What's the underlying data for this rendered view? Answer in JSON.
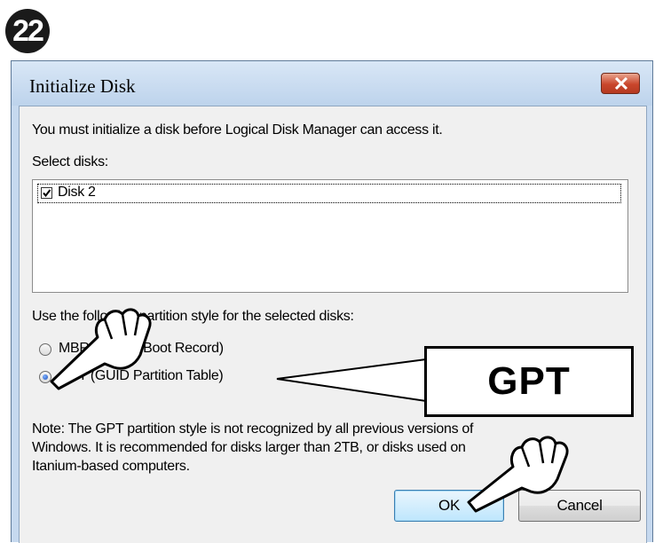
{
  "step_number": "22",
  "dialog": {
    "title": "Initialize Disk",
    "message": "You must initialize a disk before Logical Disk Manager can access it.",
    "select_disks_label": "Select disks:",
    "disks": [
      {
        "label": "Disk 2",
        "checked": true
      }
    ],
    "partition_style_label": "Use the following partition style for the selected disks:",
    "partition_options": [
      {
        "label": "MBR (Master Boot Record)",
        "selected": false
      },
      {
        "label": "GPT (GUID Partition Table)",
        "selected": true
      }
    ],
    "note_lines": [
      "Note: The GPT partition style is not recognized by all previous versions of",
      "Windows. It is recommended for disks larger than 2TB, or disks used on",
      "Itanium-based computers."
    ],
    "ok_label": "OK",
    "cancel_label": "Cancel"
  },
  "callout": {
    "label": "GPT"
  },
  "colors": {
    "window_frame": "#c6d9ef",
    "client_bg": "#f0f0f0",
    "close_button": "#c9462c",
    "ok_button": "#bee6fd"
  }
}
